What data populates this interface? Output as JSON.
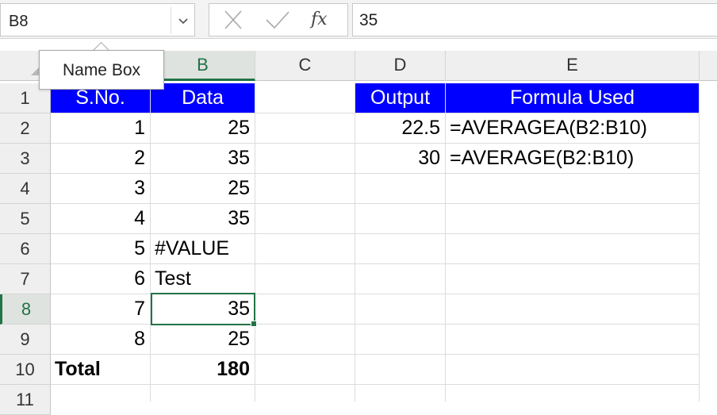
{
  "name_box": {
    "value": "B8",
    "tooltip": "Name Box"
  },
  "formula_bar": {
    "cancel_icon": "x-icon",
    "enter_icon": "check-icon",
    "fx_label": "fx",
    "value": "35"
  },
  "columns": [
    "B",
    "C",
    "D",
    "E"
  ],
  "rows": [
    "1",
    "2",
    "3",
    "4",
    "5",
    "6",
    "7",
    "8",
    "9",
    "10",
    "11"
  ],
  "cells": {
    "A1": "S.No.",
    "B1": "Data",
    "D1": "Output",
    "E1": "Formula Used",
    "A2": "1",
    "B2": "25",
    "D2": "22.5",
    "E2": "=AVERAGEA(B2:B10)",
    "A3": "2",
    "B3": "35",
    "D3": "30",
    "E3": "=AVERAGE(B2:B10)",
    "A4": "3",
    "B4": "25",
    "A5": "4",
    "B5": "35",
    "A6": "5",
    "B6": "#VALUE",
    "A7": "6",
    "B7": "Test",
    "A8": "7",
    "B8": "35",
    "A9": "8",
    "B9": "25",
    "A10": "Total",
    "B10": "180"
  },
  "colors": {
    "header_fill": "#0000ff",
    "selection": "#217346"
  }
}
